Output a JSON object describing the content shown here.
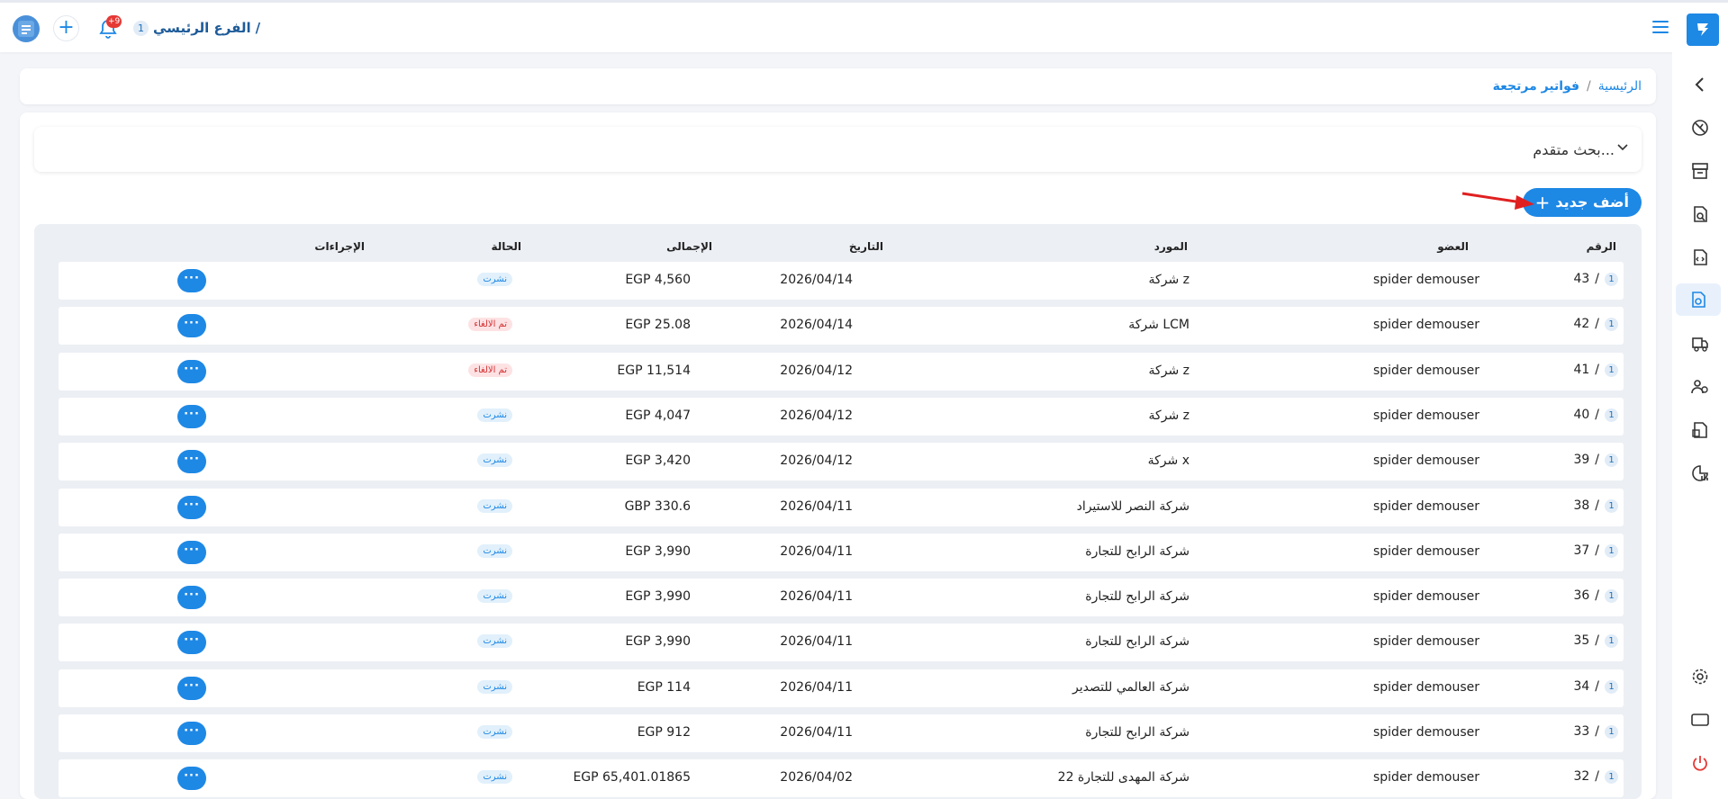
{
  "header": {
    "branch_name": "الفرع الرئيسي",
    "branch_separator": "/",
    "branch_number": "1",
    "notifications_count": "+9"
  },
  "breadcrumb": {
    "home": "الرئيسية",
    "separator": "/",
    "current": "فواتير مرتجعة"
  },
  "search": {
    "label": "بحث متقدم..."
  },
  "toolbar": {
    "add_label": "أضف جديد",
    "add_plus": "+"
  },
  "table": {
    "headers": {
      "number": "الرقم",
      "member": "العضو",
      "supplier": "المورد",
      "date": "التاريخ",
      "total": "الإجمالى",
      "status": "الحالة",
      "actions": "الإجراءات"
    },
    "actions_label": "···",
    "rows": [
      {
        "branch": "1",
        "sep": "/",
        "number": "43",
        "member": "spider demouser",
        "supplier": "شركة z",
        "date": "2026/04/14",
        "total": "EGP 4,560",
        "status": "نشرت"
      },
      {
        "branch": "1",
        "sep": "/",
        "number": "42",
        "member": "spider demouser",
        "supplier": "شركة LCM",
        "date": "2026/04/14",
        "total": "EGP 25.08",
        "status": "تم الالغاء"
      },
      {
        "branch": "1",
        "sep": "/",
        "number": "41",
        "member": "spider demouser",
        "supplier": "شركة z",
        "date": "2026/04/12",
        "total": "EGP 11,514",
        "status": "تم الالغاء"
      },
      {
        "branch": "1",
        "sep": "/",
        "number": "40",
        "member": "spider demouser",
        "supplier": "شركة z",
        "date": "2026/04/12",
        "total": "EGP 4,047",
        "status": "نشرت"
      },
      {
        "branch": "1",
        "sep": "/",
        "number": "39",
        "member": "spider demouser",
        "supplier": "شركة x",
        "date": "2026/04/12",
        "total": "EGP 3,420",
        "status": "نشرت"
      },
      {
        "branch": "1",
        "sep": "/",
        "number": "38",
        "member": "spider demouser",
        "supplier": "شركة النصر للاستيراد",
        "date": "2026/04/11",
        "total": "GBP 330.6",
        "status": "نشرت"
      },
      {
        "branch": "1",
        "sep": "/",
        "number": "37",
        "member": "spider demouser",
        "supplier": "شركة الرابح للتجارة",
        "date": "2026/04/11",
        "total": "EGP 3,990",
        "status": "نشرت"
      },
      {
        "branch": "1",
        "sep": "/",
        "number": "36",
        "member": "spider demouser",
        "supplier": "شركة الرابح للتجارة",
        "date": "2026/04/11",
        "total": "EGP 3,990",
        "status": "نشرت"
      },
      {
        "branch": "1",
        "sep": "/",
        "number": "35",
        "member": "spider demouser",
        "supplier": "شركة الرابح للتجارة",
        "date": "2026/04/11",
        "total": "EGP 3,990",
        "status": "نشرت"
      },
      {
        "branch": "1",
        "sep": "/",
        "number": "34",
        "member": "spider demouser",
        "supplier": "شركة العالمي للتصدير",
        "date": "2026/04/11",
        "total": "EGP 114",
        "status": "نشرت"
      },
      {
        "branch": "1",
        "sep": "/",
        "number": "33",
        "member": "spider demouser",
        "supplier": "شركة الرابح للتجارة",
        "date": "2026/04/11",
        "total": "EGP 912",
        "status": "نشرت"
      },
      {
        "branch": "1",
        "sep": "/",
        "number": "32",
        "member": "spider demouser",
        "supplier": "شركة المهدى للتجارة 22",
        "date": "2026/04/02",
        "total": "EGP 65,401.01865",
        "status": "نشرت"
      }
    ]
  },
  "sidebar": {
    "items": [
      "collapse-icon",
      "dashboard-icon",
      "invoices-icon",
      "search-doc-icon",
      "doc-code-icon",
      "returns-icon",
      "shipping-icon",
      "users-icon",
      "inventory-icon",
      "reports-icon",
      "settings-icon",
      "screen-icon",
      "power-icon"
    ]
  },
  "colors": {
    "accent": "#1e88e5",
    "cancel": "#d32f2f",
    "arrow": "#e02020"
  }
}
